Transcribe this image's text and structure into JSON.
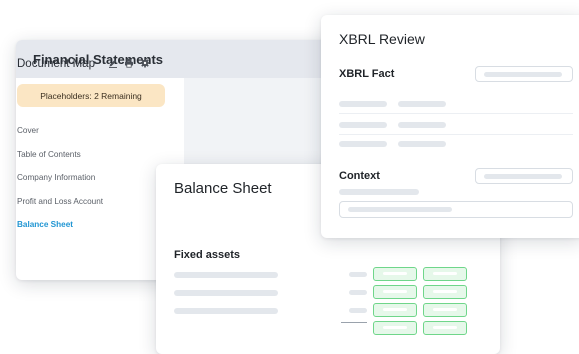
{
  "financial_statements": {
    "title": "Financial Statements",
    "doc_map_title": "Document Map",
    "icons": [
      "edit-icon",
      "print-icon",
      "gear-icon"
    ],
    "placeholder_badge": "Placeholders: 2 Remaining",
    "nav_items": [
      {
        "label": "Cover",
        "active": false
      },
      {
        "label": "Table of Contents",
        "active": false
      },
      {
        "label": "Company Information",
        "active": false
      },
      {
        "label": "Profit and Loss Account",
        "active": false
      },
      {
        "label": "Balance Sheet",
        "active": true
      }
    ]
  },
  "balance_sheet": {
    "title": "Balance Sheet",
    "section": "Fixed assets"
  },
  "xbrl_review": {
    "title": "XBRL Review",
    "fact_label": "XBRL Fact",
    "context_label": "Context"
  },
  "colors": {
    "active_nav": "#2196d3",
    "badge_bg": "#fbe6c4",
    "tag_green": "#6fd68a"
  }
}
